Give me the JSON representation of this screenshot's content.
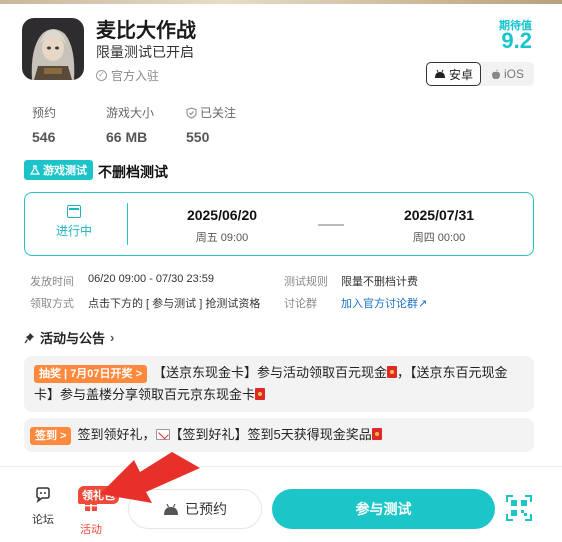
{
  "game": {
    "title": "麦比大作战",
    "subtitle": "限量测试已开启",
    "official": "官方入驻",
    "rating_label": "期待值",
    "rating": "9.2"
  },
  "platform": {
    "android": "安卓",
    "ios": "iOS",
    "selected": "安卓"
  },
  "stats": [
    {
      "label": "预约",
      "value": "546"
    },
    {
      "label": "游戏大小",
      "value": "66 MB"
    },
    {
      "label": "已关注",
      "value": "550"
    }
  ],
  "test": {
    "badge": "游戏测试",
    "type": "不删档测试",
    "status": "进行中",
    "start_date": "2025/06/20",
    "start_week": "周五 09:00",
    "end_date": "2025/07/31",
    "end_week": "周四 00:00"
  },
  "info": {
    "time_key": "发放时间",
    "time_val": "06/20 09:00 - 07/30 23:59",
    "rule_key": "测试规则",
    "rule_val": "限量不删档计费",
    "method_key": "领取方式",
    "method_val": "点击下方的 [ 参与测试 ] 抢测试资格",
    "group_key": "讨论群",
    "group_val": "加入官方讨论群↗"
  },
  "activities": {
    "section_title": "活动与公告",
    "item1_tag": "抽奖 | 7月07日开奖 >",
    "item1_text_a": "【送京东现金卡】参与活动领取百元现金",
    "item1_text_b": "，【送京东百元现金卡】参与盖楼分享领取百元京东现金卡",
    "item2_tag": "签到 >",
    "item2_text_a": "签到领好礼，",
    "item2_text_b": "【签到好礼】签到5天获得现金奖品"
  },
  "bottom": {
    "forum": "论坛",
    "activity": "活动",
    "gift_badge": "领礼包",
    "reserved": "已预约",
    "join": "参与测试"
  },
  "colors": {
    "accent": "#1cc6c8",
    "orange": "#ff8a3d",
    "red": "#e02828"
  }
}
